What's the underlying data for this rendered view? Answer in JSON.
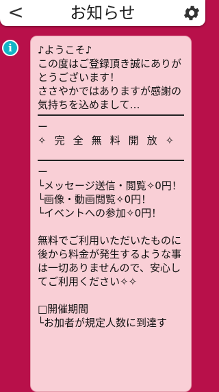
{
  "header": {
    "back_glyph": "<",
    "title": "お知らせ",
    "settings_icon": "gear-icon"
  },
  "message": {
    "info_icon_letter": "i",
    "p1": "♪ようこそ♪\nこの度はご登録頂き誠にありがとうございます！\nささやかではありますが感謝の気持ちを込めまして…",
    "dash1": "ー",
    "free_banner": "✧完全無料開放✧",
    "dash2": "ー",
    "list": "└メッセージ送信・閲覧✧0円！\n└画像・動画閲覧✧0円！\n└イベントへの参加✧0円！",
    "p2": "無料でご利用いただいたものに後から料金が発生するような事は一切ありませんので、安心してご利用ください✧✧",
    "period_heading": "□開催期間",
    "period_text": "└お加者が規定人数に到達す"
  },
  "colors": {
    "background": "#b8104a",
    "bubble": "#f9cfd6",
    "info_icon": "#12b4c6"
  }
}
